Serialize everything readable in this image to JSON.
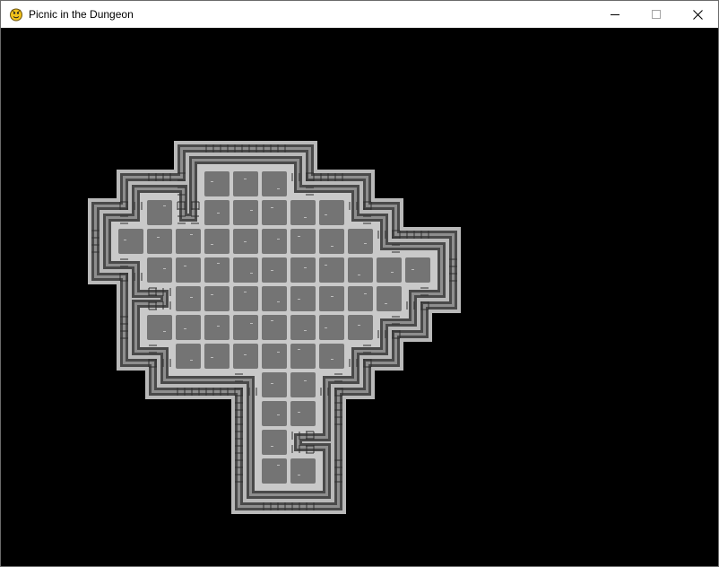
{
  "window": {
    "title": "Picnic in the Dungeon",
    "icon": "pygame-snake-icon",
    "controls": [
      "minimize-icon",
      "maximize-icon",
      "close-icon"
    ]
  },
  "game": {
    "background": "#000000",
    "colors": {
      "floor_tile": "#747474",
      "floor_grout": "#c9c9c9",
      "wall_light": "#b9b9b9",
      "wall_dark": "#4a4a4a",
      "wall_mid": "#8e8e8e"
    },
    "grid_cols": 10,
    "grid_rows": 11,
    "floor_rows": [
      "...ooo....",
      ".o.ooooo..",
      "ooooooooo.",
      ".oooooooooo",
      "..oooooooo",
      ".oooooooo.",
      "..oooooo..",
      ".....oo...",
      ".....oo...",
      ".....o....",
      ".....oo..."
    ]
  }
}
